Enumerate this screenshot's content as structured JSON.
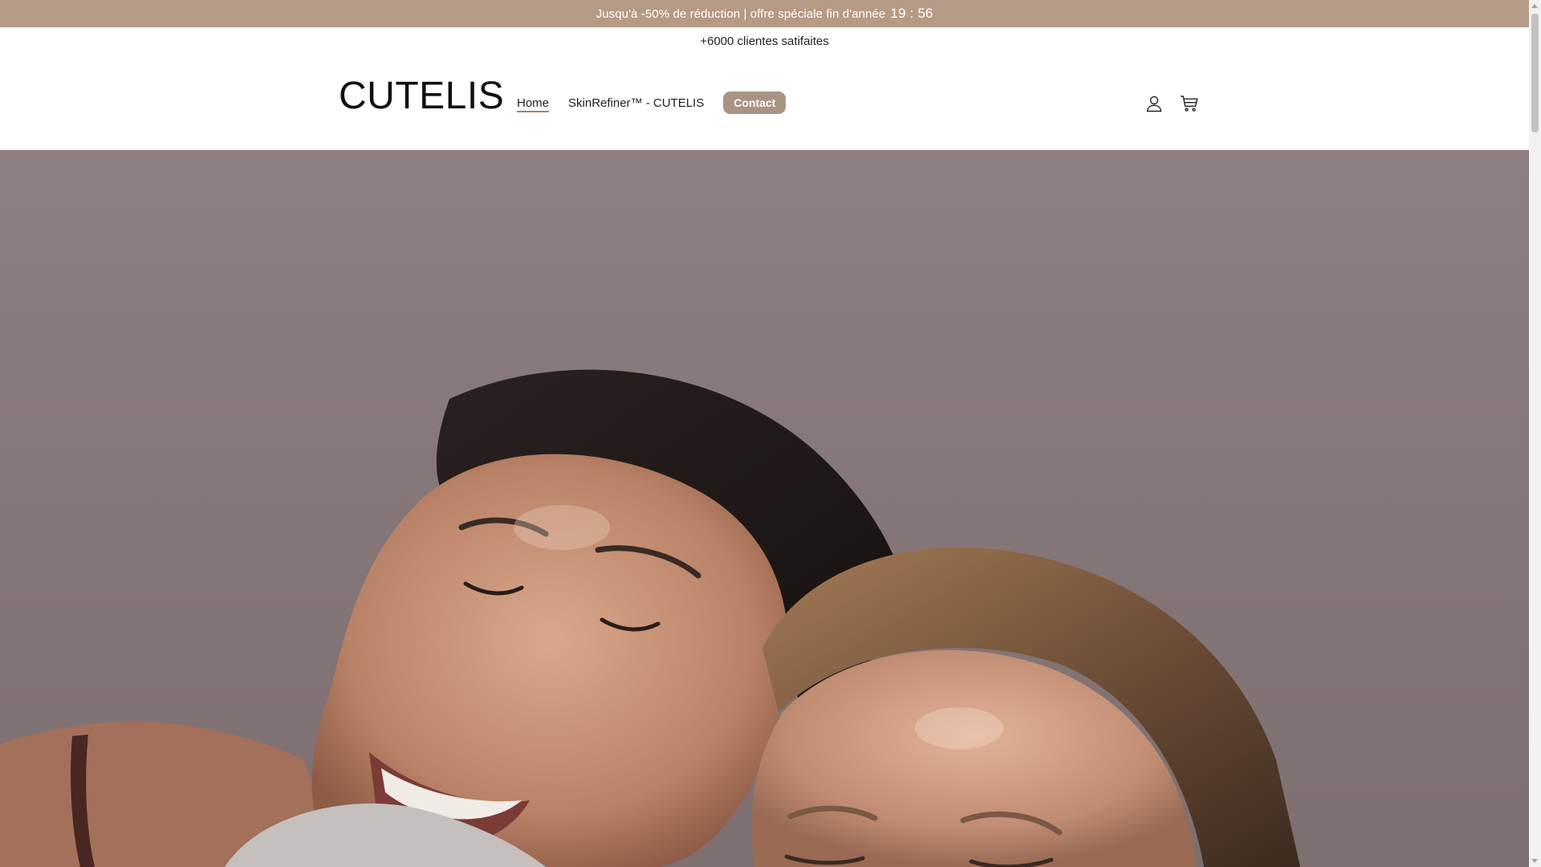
{
  "announcement": {
    "text": "Jusqu'à -50% de réduction | offre spéciale fin d'année",
    "timer_minutes": "19",
    "timer_separator": ":",
    "timer_seconds": "56",
    "background_color": "#b59a86"
  },
  "subbar": {
    "text": "+6000 clientes satifaites"
  },
  "header": {
    "logo": "CUTELIS",
    "nav": {
      "items": [
        {
          "label": "Home",
          "active": true
        },
        {
          "label": "SkinRefiner™ - CUTELIS",
          "active": false
        }
      ],
      "contact_label": "Contact"
    },
    "icons": {
      "account": "user-icon",
      "cart": "cart-icon"
    }
  },
  "hero": {
    "image": "two smiling women cheek to cheek",
    "image_type": "photo"
  }
}
